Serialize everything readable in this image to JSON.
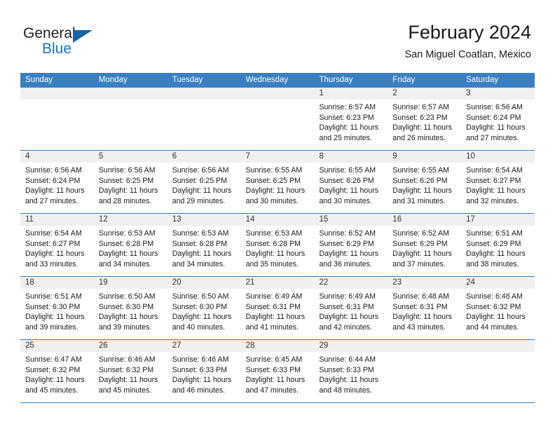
{
  "brand": {
    "name_top": "General",
    "name_bottom": "Blue",
    "accent_color": "#1763a8"
  },
  "header": {
    "title": "February 2024",
    "subtitle": "San Miguel Coatlan, Mexico"
  },
  "theme": {
    "header_bar_color": "#3a7fc1",
    "daynum_band_color": "#f0f0f0",
    "grid_line_color": "#3a7fc1"
  },
  "weekdays": [
    "Sunday",
    "Monday",
    "Tuesday",
    "Wednesday",
    "Thursday",
    "Friday",
    "Saturday"
  ],
  "labels": {
    "sunrise_prefix": "Sunrise:",
    "sunset_prefix": "Sunset:",
    "daylight_prefix": "Daylight:"
  },
  "weeks": [
    [
      {
        "day": "",
        "empty": true
      },
      {
        "day": "",
        "empty": true
      },
      {
        "day": "",
        "empty": true
      },
      {
        "day": "",
        "empty": true
      },
      {
        "day": "1",
        "sunrise": "Sunrise: 6:57 AM",
        "sunset": "Sunset: 6:23 PM",
        "daylight": "Daylight: 11 hours and 25 minutes."
      },
      {
        "day": "2",
        "sunrise": "Sunrise: 6:57 AM",
        "sunset": "Sunset: 6:23 PM",
        "daylight": "Daylight: 11 hours and 26 minutes."
      },
      {
        "day": "3",
        "sunrise": "Sunrise: 6:56 AM",
        "sunset": "Sunset: 6:24 PM",
        "daylight": "Daylight: 11 hours and 27 minutes."
      }
    ],
    [
      {
        "day": "4",
        "sunrise": "Sunrise: 6:56 AM",
        "sunset": "Sunset: 6:24 PM",
        "daylight": "Daylight: 11 hours and 27 minutes."
      },
      {
        "day": "5",
        "sunrise": "Sunrise: 6:56 AM",
        "sunset": "Sunset: 6:25 PM",
        "daylight": "Daylight: 11 hours and 28 minutes."
      },
      {
        "day": "6",
        "sunrise": "Sunrise: 6:56 AM",
        "sunset": "Sunset: 6:25 PM",
        "daylight": "Daylight: 11 hours and 29 minutes."
      },
      {
        "day": "7",
        "sunrise": "Sunrise: 6:55 AM",
        "sunset": "Sunset: 6:25 PM",
        "daylight": "Daylight: 11 hours and 30 minutes."
      },
      {
        "day": "8",
        "sunrise": "Sunrise: 6:55 AM",
        "sunset": "Sunset: 6:26 PM",
        "daylight": "Daylight: 11 hours and 30 minutes."
      },
      {
        "day": "9",
        "sunrise": "Sunrise: 6:55 AM",
        "sunset": "Sunset: 6:26 PM",
        "daylight": "Daylight: 11 hours and 31 minutes."
      },
      {
        "day": "10",
        "sunrise": "Sunrise: 6:54 AM",
        "sunset": "Sunset: 6:27 PM",
        "daylight": "Daylight: 11 hours and 32 minutes."
      }
    ],
    [
      {
        "day": "11",
        "sunrise": "Sunrise: 6:54 AM",
        "sunset": "Sunset: 6:27 PM",
        "daylight": "Daylight: 11 hours and 33 minutes."
      },
      {
        "day": "12",
        "sunrise": "Sunrise: 6:53 AM",
        "sunset": "Sunset: 6:28 PM",
        "daylight": "Daylight: 11 hours and 34 minutes."
      },
      {
        "day": "13",
        "sunrise": "Sunrise: 6:53 AM",
        "sunset": "Sunset: 6:28 PM",
        "daylight": "Daylight: 11 hours and 34 minutes."
      },
      {
        "day": "14",
        "sunrise": "Sunrise: 6:53 AM",
        "sunset": "Sunset: 6:28 PM",
        "daylight": "Daylight: 11 hours and 35 minutes."
      },
      {
        "day": "15",
        "sunrise": "Sunrise: 6:52 AM",
        "sunset": "Sunset: 6:29 PM",
        "daylight": "Daylight: 11 hours and 36 minutes."
      },
      {
        "day": "16",
        "sunrise": "Sunrise: 6:52 AM",
        "sunset": "Sunset: 6:29 PM",
        "daylight": "Daylight: 11 hours and 37 minutes."
      },
      {
        "day": "17",
        "sunrise": "Sunrise: 6:51 AM",
        "sunset": "Sunset: 6:29 PM",
        "daylight": "Daylight: 11 hours and 38 minutes."
      }
    ],
    [
      {
        "day": "18",
        "sunrise": "Sunrise: 6:51 AM",
        "sunset": "Sunset: 6:30 PM",
        "daylight": "Daylight: 11 hours and 39 minutes."
      },
      {
        "day": "19",
        "sunrise": "Sunrise: 6:50 AM",
        "sunset": "Sunset: 6:30 PM",
        "daylight": "Daylight: 11 hours and 39 minutes."
      },
      {
        "day": "20",
        "sunrise": "Sunrise: 6:50 AM",
        "sunset": "Sunset: 6:30 PM",
        "daylight": "Daylight: 11 hours and 40 minutes."
      },
      {
        "day": "21",
        "sunrise": "Sunrise: 6:49 AM",
        "sunset": "Sunset: 6:31 PM",
        "daylight": "Daylight: 11 hours and 41 minutes."
      },
      {
        "day": "22",
        "sunrise": "Sunrise: 6:49 AM",
        "sunset": "Sunset: 6:31 PM",
        "daylight": "Daylight: 11 hours and 42 minutes."
      },
      {
        "day": "23",
        "sunrise": "Sunrise: 6:48 AM",
        "sunset": "Sunset: 6:31 PM",
        "daylight": "Daylight: 11 hours and 43 minutes."
      },
      {
        "day": "24",
        "sunrise": "Sunrise: 6:48 AM",
        "sunset": "Sunset: 6:32 PM",
        "daylight": "Daylight: 11 hours and 44 minutes."
      }
    ],
    [
      {
        "day": "25",
        "sunrise": "Sunrise: 6:47 AM",
        "sunset": "Sunset: 6:32 PM",
        "daylight": "Daylight: 11 hours and 45 minutes."
      },
      {
        "day": "26",
        "sunrise": "Sunrise: 6:46 AM",
        "sunset": "Sunset: 6:32 PM",
        "daylight": "Daylight: 11 hours and 45 minutes."
      },
      {
        "day": "27",
        "sunrise": "Sunrise: 6:46 AM",
        "sunset": "Sunset: 6:33 PM",
        "daylight": "Daylight: 11 hours and 46 minutes."
      },
      {
        "day": "28",
        "sunrise": "Sunrise: 6:45 AM",
        "sunset": "Sunset: 6:33 PM",
        "daylight": "Daylight: 11 hours and 47 minutes."
      },
      {
        "day": "29",
        "sunrise": "Sunrise: 6:44 AM",
        "sunset": "Sunset: 6:33 PM",
        "daylight": "Daylight: 11 hours and 48 minutes."
      },
      {
        "day": "",
        "empty": true
      },
      {
        "day": "",
        "empty": true
      }
    ]
  ]
}
